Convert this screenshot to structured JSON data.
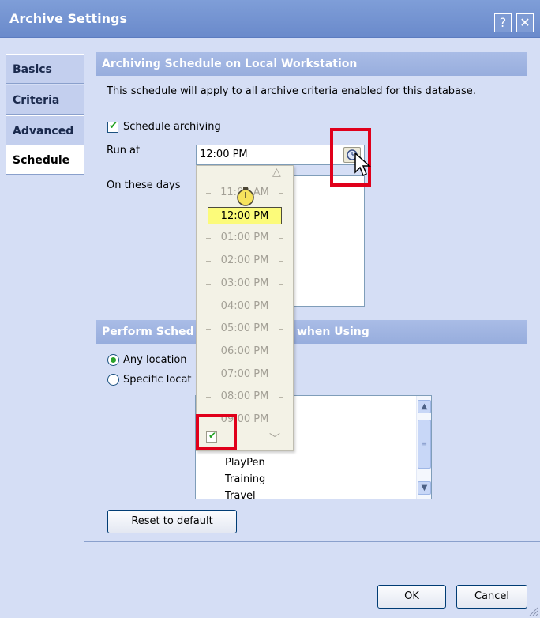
{
  "window": {
    "title": "Archive Settings",
    "help_glyph": "?",
    "close_glyph": "✕"
  },
  "tabs": [
    {
      "label": "Basics"
    },
    {
      "label": "Criteria"
    },
    {
      "label": "Advanced"
    },
    {
      "label": "Schedule"
    }
  ],
  "schedule": {
    "header": "Archiving Schedule on Local Workstation",
    "description": "This schedule will apply to all archive criteria enabled for this database.",
    "schedule_archiving_label": "Schedule archiving",
    "schedule_archiving_checked": true,
    "run_at_label": "Run at",
    "run_at_value": "12:00 PM",
    "on_these_days_label": "On these days"
  },
  "time_dropdown": {
    "up_arrow": "△",
    "down_arrow": "﹀",
    "items": [
      "11:00 AM",
      "12:00 PM",
      "01:00 PM",
      "02:00 PM",
      "03:00 PM",
      "04:00 PM",
      "05:00 PM",
      "06:00 PM",
      "07:00 PM",
      "08:00 PM",
      "09:00 PM"
    ],
    "selected": "12:00 PM"
  },
  "perform": {
    "header_left": "Perform Sched",
    "header_right": "when Using",
    "any_location_label": "Any location",
    "specific_location_label": "Specific locat",
    "selected_option": "any_location",
    "locations": [
      "PlayPen",
      "Training",
      "Travel"
    ]
  },
  "buttons": {
    "reset": "Reset to default",
    "ok": "OK",
    "cancel": "Cancel"
  },
  "colors": {
    "titlebar": "#7f9ed8",
    "section_header": "#a9bce6",
    "highlight_box": "#e0001b",
    "selected_time": "#fcfb7a"
  }
}
